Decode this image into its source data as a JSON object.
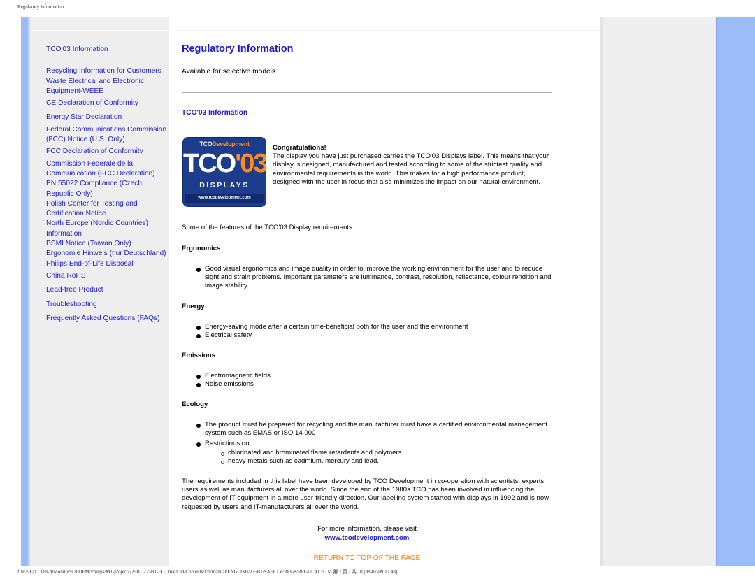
{
  "print_header": "Regulatory Information",
  "print_footer": "file:///E|/LCD%20Monitor%20OEM/Philips/M1-project/225B1/225B1-ED...mat/CD-Contents/lcd/manual/ENGLISH/225B1/SAFETY/REGS/REGULAT.HTM 第 1 頁 / 共 10 [98-07-09 17:43]",
  "nav": {
    "items": [
      {
        "label": "TCO'03 Information"
      },
      {
        "label": "Recycling Information for Customers"
      },
      {
        "label": "Waste Electrical and Electronic Equipment-WEEE"
      },
      {
        "label": "CE Declaration of Conformity"
      },
      {
        "label": "Energy Star Declaration"
      },
      {
        "label": "Federal Communications Commission (FCC) Notice (U.S. Only)"
      },
      {
        "label": "FCC Declaration of Conformity"
      },
      {
        "label": "Commission Federale de la Communication (FCC Declaration)"
      },
      {
        "label": "EN 55022 Compliance (Czech Republic Only)"
      },
      {
        "label": "Polish Center for Testing and Certification Notice"
      },
      {
        "label": "North Europe (Nordic Countries) Information"
      },
      {
        "label": "BSMI Notice (Taiwan Only)"
      },
      {
        "label": "Ergonomie Hinweis (nur Deutschland)"
      },
      {
        "label": "Philips End-of-Life Disposal"
      },
      {
        "label": "China RoHS"
      },
      {
        "label": "Lead-free Product"
      },
      {
        "label": "Troubleshooting"
      },
      {
        "label": "Frequently Asked Questions (FAQs)"
      }
    ]
  },
  "main": {
    "title": "Regulatory Information",
    "subtitle": "Available for selective models",
    "section_link": "TCO'03 Information",
    "logo": {
      "top_brand": "TCO",
      "top_word": "Development",
      "big_left": "TCO",
      "big_right": "'03",
      "displays": "DISPLAYS",
      "url": "www.tcodevelopment.com"
    },
    "congrats_heading": "Congratulations!",
    "congrats_body": "The display you have just purchased carries the TCO'03 Displays label. This means that your display is designed, manufactured and tested according to some of the strictest quality and environmental requirements in the world. This makes for a high performance product, designed with the user in focus that also minimizes the impact on our natural environment.",
    "features_intro": "Some of the features of the TCO'03 Display requirements.",
    "sections": {
      "ergonomics": {
        "heading": "Ergonomics",
        "items": [
          "Good visual ergonomics and image quality in order to improve the working environment for the user and to reduce sight and strain problems. Important parameters are luminance, contrast, resolution, reflectance, colour rendition and image stability."
        ]
      },
      "energy": {
        "heading": "Energy",
        "items": [
          "Energy-saving mode after a certain time-beneficial both for the user and the environment",
          "Electrical safety"
        ]
      },
      "emissions": {
        "heading": "Emissions",
        "items": [
          "Electromagnetic fields",
          "Noise emissions"
        ]
      },
      "ecology": {
        "heading": "Ecology",
        "items": [
          "The product must be prepared for recycling and the manufacturer must have a certified environmental management system such as EMAS or ISO 14 000",
          "Restrictions on"
        ],
        "subitems": [
          "chlorinated and brominated flame retardants and polymers",
          "heavy metals such as cadmium, mercury and lead."
        ]
      }
    },
    "closing": "The requirements included in this label have been developed by TCO Development in co-operation with scientists, experts, users as well as manufacturers all over the world. Since the end of the 1980s TCO has been involved in influencing the development of IT equipment in a more user-friendly direction. Our labelling system started with displays in 1992 and is now requested by users and IT-manufacturers all over the world.",
    "more_info": "For more information, please visit",
    "more_url": "www.tcodevelopment.com",
    "return_top": "RETURN TO TOP OF THE PAGE"
  },
  "colors": {
    "link": "#1a1adc",
    "accent_orange": "#ff7a1a",
    "side_blue": "#9bbcf9",
    "panel_gray": "#eeeeee"
  }
}
